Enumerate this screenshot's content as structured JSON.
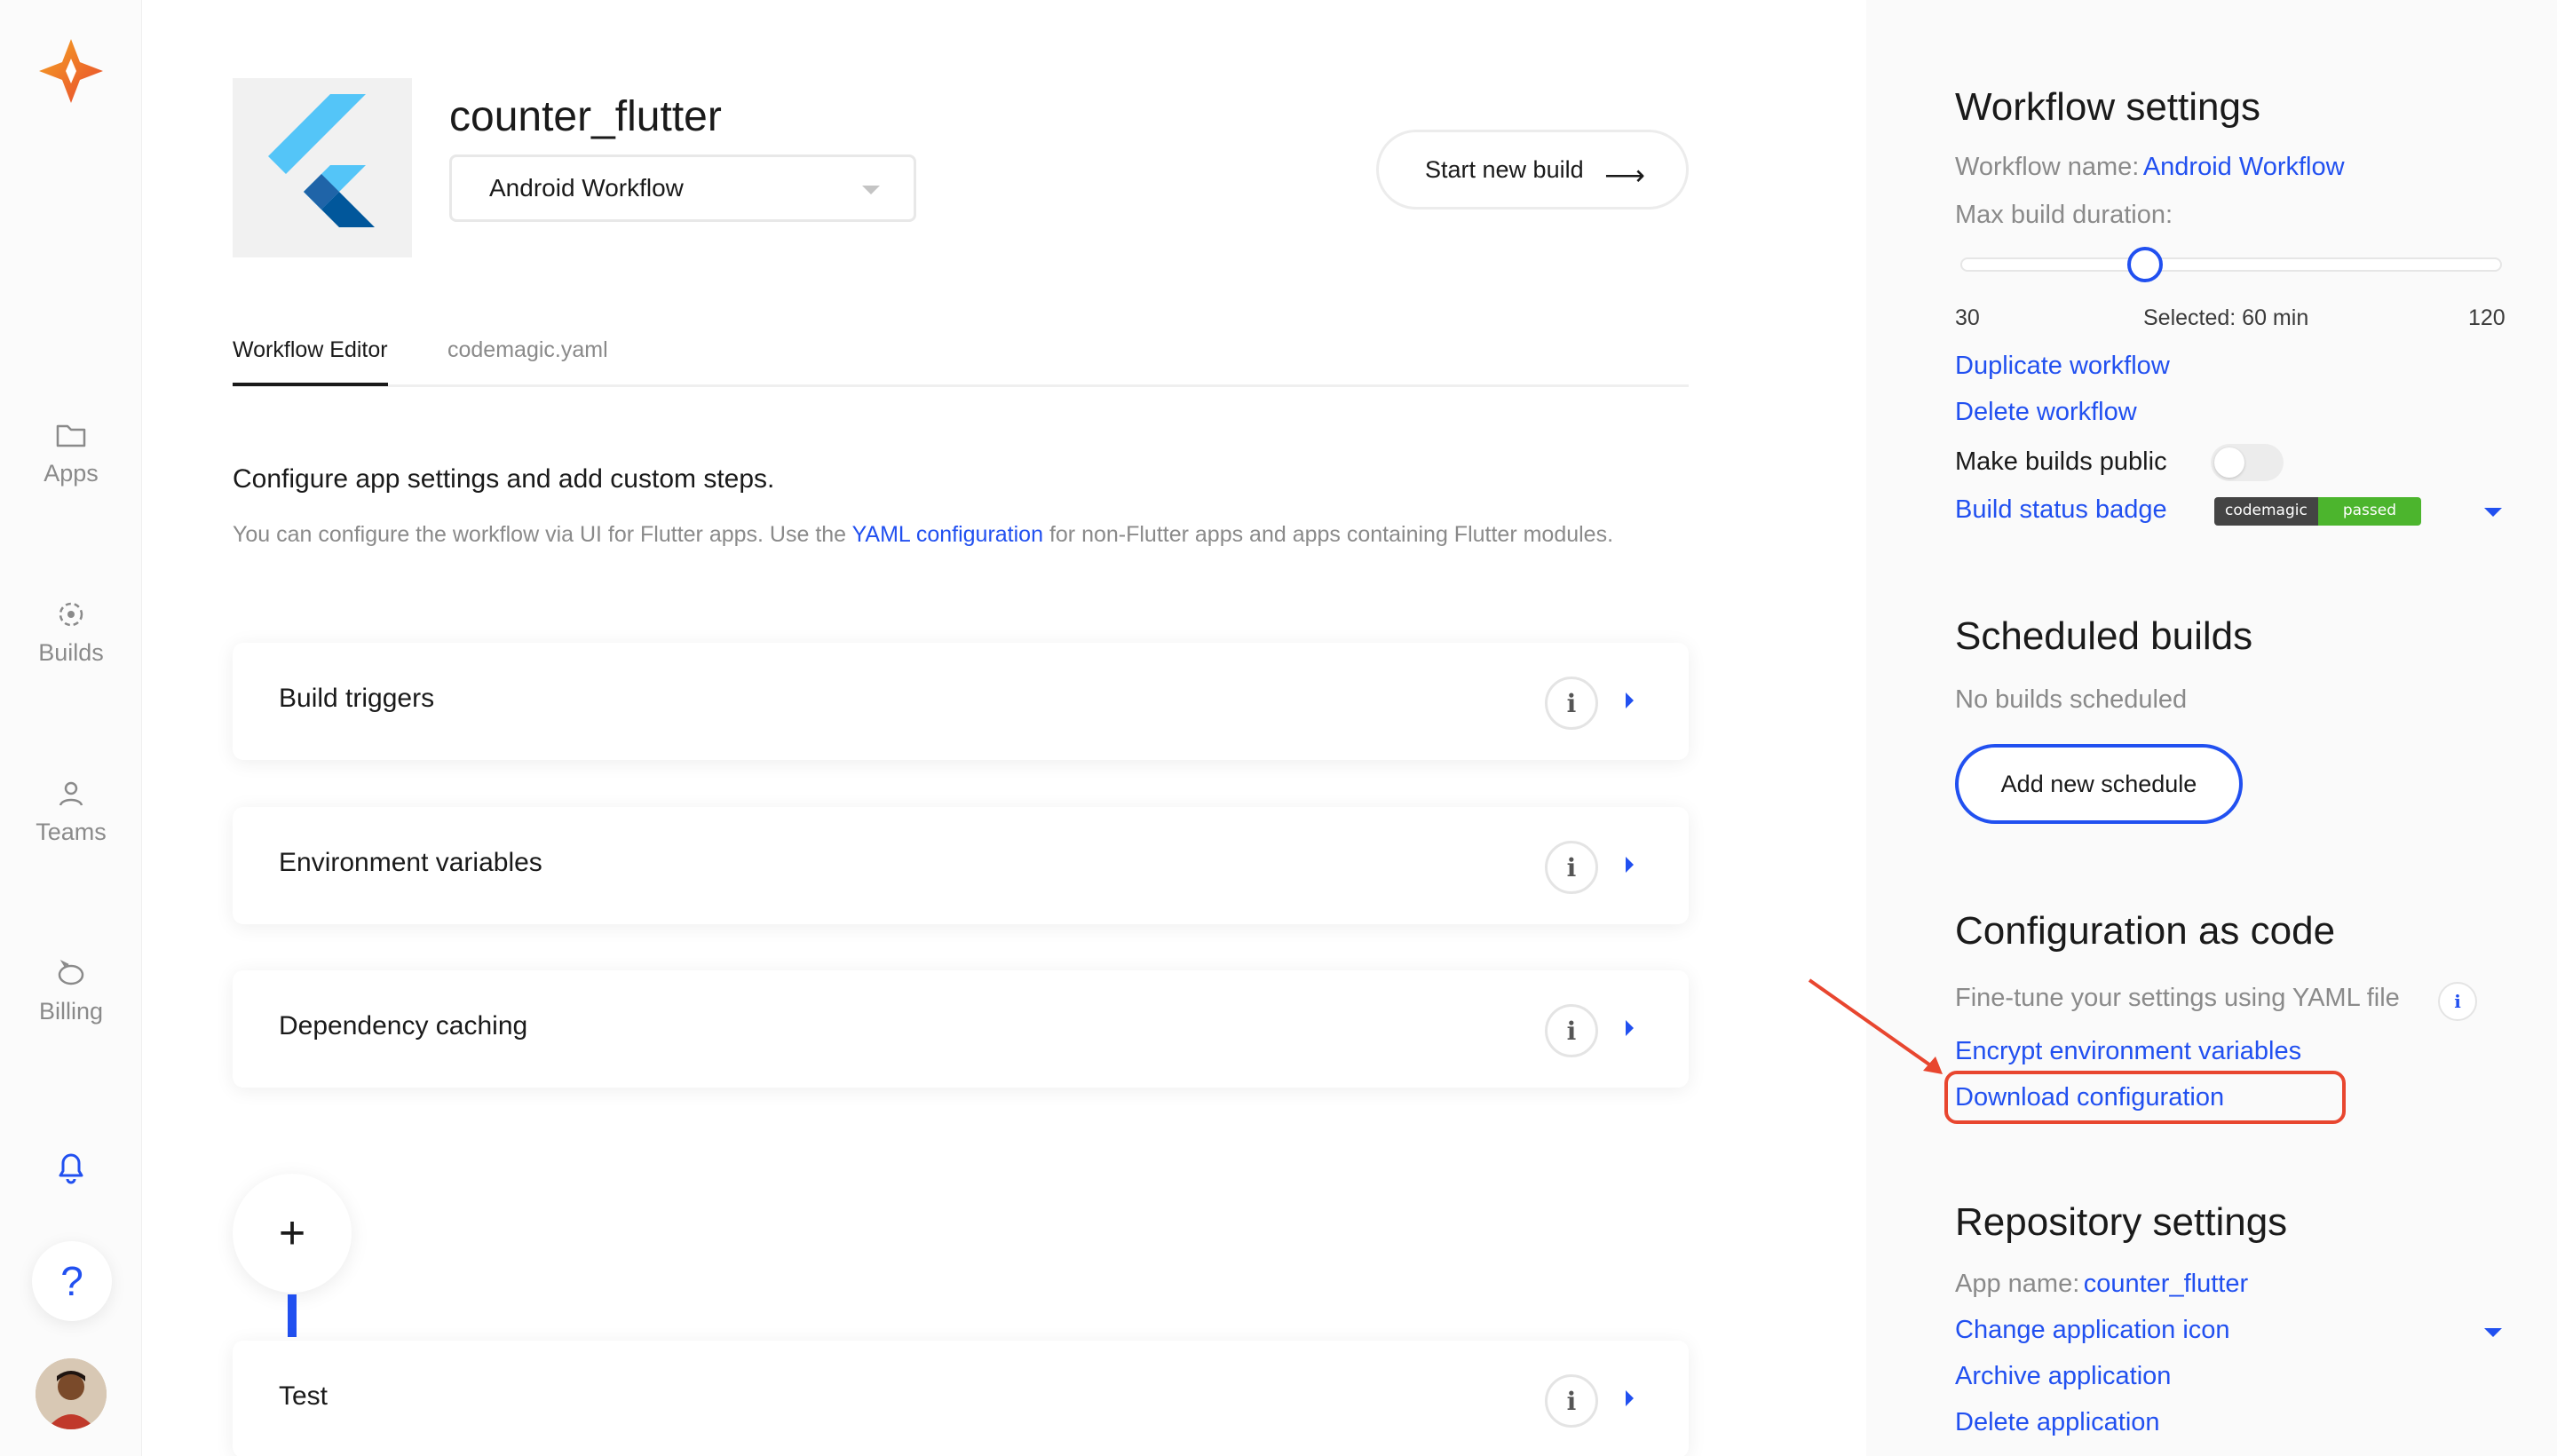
{
  "nav": {
    "items": [
      {
        "label": "Apps",
        "icon": "folder-icon"
      },
      {
        "label": "Builds",
        "icon": "builds-icon"
      },
      {
        "label": "Teams",
        "icon": "user-icon"
      },
      {
        "label": "Billing",
        "icon": "piggy-bank-icon"
      }
    ],
    "help_label": "?"
  },
  "app": {
    "title": "counter_flutter",
    "workflow_selected": "Android Workflow",
    "start_build_label": "Start new build",
    "start_build_arrow": "⟶"
  },
  "tabs": [
    {
      "label": "Workflow Editor",
      "active": true
    },
    {
      "label": "codemagic.yaml",
      "active": false
    }
  ],
  "main": {
    "heading": "Configure app settings and add custom steps.",
    "desc_before": "You can configure the workflow via UI for Flutter apps. Use the ",
    "desc_link": "YAML configuration",
    "desc_after": " for non-Flutter apps and apps containing Flutter modules.",
    "cards": [
      "Build triggers",
      "Environment variables",
      "Dependency caching",
      "Test"
    ],
    "info_glyph": "i",
    "add_step": "+"
  },
  "workflow_settings": {
    "title": "Workflow settings",
    "name_label": "Workflow name:",
    "name_value": "Android Workflow",
    "duration_label": "Max build duration:",
    "slider_min": "30",
    "slider_selected": "Selected: 60 min",
    "slider_max": "120",
    "slider_value_fraction": 0.333,
    "duplicate": "Duplicate workflow",
    "delete": "Delete workflow",
    "make_public": "Make builds public",
    "make_public_on": false,
    "badge_label": "Build status badge",
    "badge_left": "codemagic",
    "badge_right": "passed"
  },
  "scheduled": {
    "title": "Scheduled builds",
    "empty": "No builds scheduled",
    "add_label": "Add new schedule"
  },
  "config_code": {
    "title": "Configuration as code",
    "desc": "Fine-tune your settings using YAML file",
    "encrypt": "Encrypt environment variables",
    "download": "Download configuration"
  },
  "repo": {
    "title": "Repository settings",
    "app_name_label": "App name:",
    "app_name_value": "counter_flutter",
    "change_icon": "Change application icon",
    "archive": "Archive application",
    "delete": "Delete application"
  },
  "colors": {
    "accent": "#2150f0",
    "annotation": "#e8462f",
    "badge_green": "#4cb52d"
  }
}
